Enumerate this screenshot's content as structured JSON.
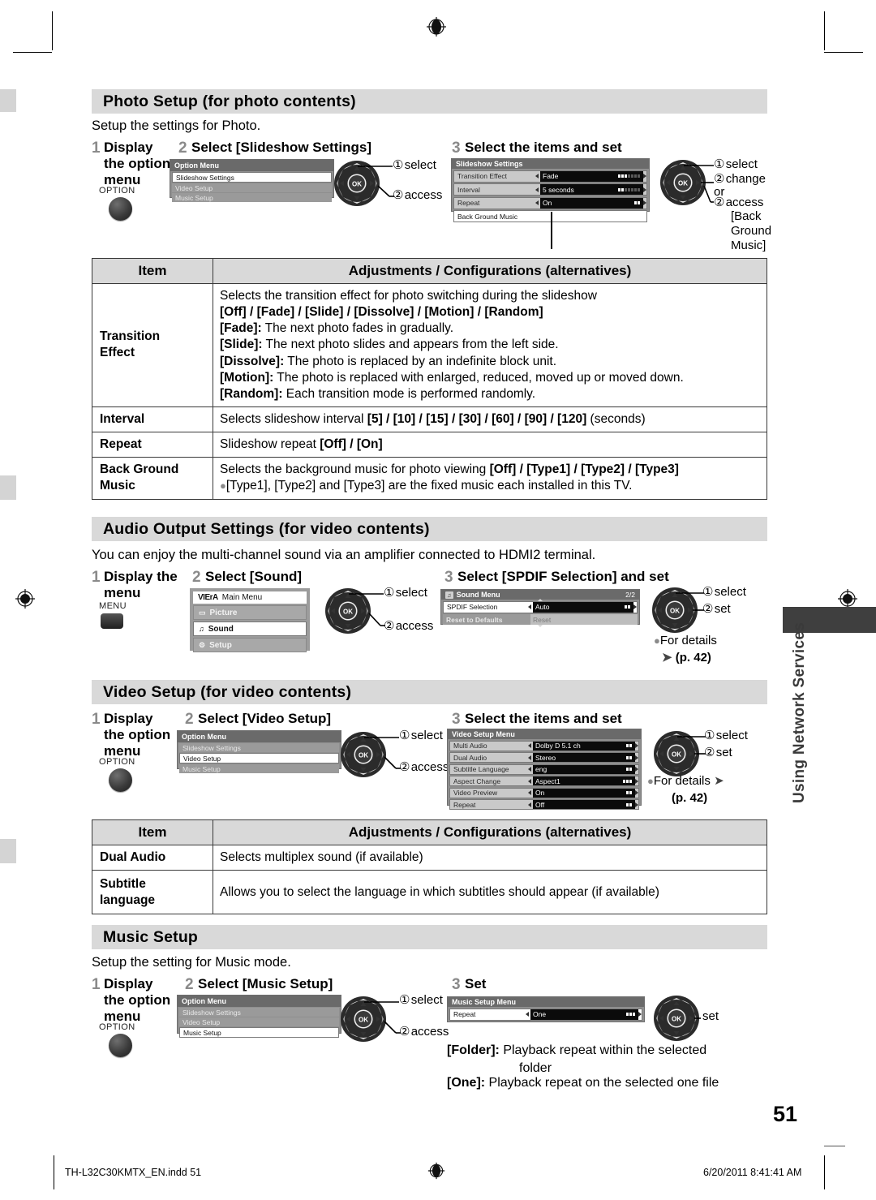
{
  "document": {
    "page_number": "51",
    "footer_left": "TH-L32C30KMTX_EN.indd   51",
    "footer_right": "6/20/2011   8:41:41 AM",
    "side_tab_text": "Using Network Services"
  },
  "sections": [
    {
      "id": "photo_setup",
      "heading": "Photo Setup (for photo contents)",
      "intro": "Setup the settings for Photo.",
      "steps": [
        {
          "num": "1",
          "label": "Display\nthe option\nmenu",
          "button_label": "OPTION"
        },
        {
          "num": "2",
          "label": "Select [Slideshow Settings]"
        },
        {
          "num": "3",
          "label": "Select the items and set"
        }
      ],
      "option_menu": {
        "title": "Option Menu",
        "rows": [
          {
            "label": "Slideshow Settings",
            "state": "selected"
          },
          {
            "label": "Video Setup",
            "state": "dim"
          },
          {
            "label": "Music Setup",
            "state": "dim"
          }
        ]
      },
      "dpad_left": {
        "items": [
          "select",
          "access"
        ],
        "numbers": [
          "1",
          "2"
        ]
      },
      "slideshow_menu": {
        "title": "Slideshow Settings",
        "rows": [
          {
            "label": "Transition Effect",
            "value": "Fade",
            "bars": 7,
            "filled": 3
          },
          {
            "label": "Interval",
            "value": "5 seconds",
            "bars": 7,
            "filled": 2
          },
          {
            "label": "Repeat",
            "value": "On",
            "bars": 2,
            "filled": 2
          },
          {
            "label": "Back Ground Music",
            "value": "",
            "plain": true
          }
        ]
      },
      "dpad_right": {
        "lines": [
          "① select",
          "② change",
          "or",
          "② access"
        ],
        "trailing": [
          "[Back",
          "Ground",
          "Music]"
        ]
      },
      "table": {
        "headers": [
          "Item",
          "Adjustments / Configurations (alternatives)"
        ],
        "rows": [
          {
            "item": "Transition\nEffect",
            "lines": [
              {
                "text": "Selects the transition effect for photo switching during the slideshow"
              },
              {
                "text": "[Off] / [Fade] / [Slide] / [Dissolve] / [Motion] / [Random]",
                "bold": true
              },
              {
                "bold_prefix": "[Fade]:",
                "text": " The next photo fades in gradually."
              },
              {
                "bold_prefix": "[Slide]:",
                "text": " The next photo slides and appears from the left side."
              },
              {
                "bold_prefix": "[Dissolve]:",
                "text": " The photo is replaced by an indefinite block unit."
              },
              {
                "bold_prefix": "[Motion]:",
                "text": " The photo is replaced with enlarged, reduced, moved up or moved down."
              },
              {
                "bold_prefix": "[Random]:",
                "text": " Each transition mode is performed randomly."
              }
            ]
          },
          {
            "item": "Interval",
            "lines": [
              {
                "text": "Selects slideshow interval ",
                "suffix_bold": "[5] / [10] / [15] / [30] / [60] / [90] / [120]",
                "suffix": " (seconds)"
              }
            ]
          },
          {
            "item": "Repeat",
            "lines": [
              {
                "text": "Slideshow repeat ",
                "suffix_bold": "[Off] / [On]",
                "suffix": ""
              }
            ]
          },
          {
            "item": "Back Ground\nMusic",
            "lines": [
              {
                "text": "Selects the background music for photo viewing ",
                "suffix_bold": "[Off] / [Type1] / [Type2] / [Type3]",
                "suffix": ""
              },
              {
                "bullet": true,
                "text": "[Type1], [Type2] and [Type3] are the fixed music each installed in this TV."
              }
            ]
          }
        ]
      }
    },
    {
      "id": "audio_output",
      "heading": "Audio Output Settings (for video contents)",
      "intro": "You can enjoy the multi-channel sound via an amplifier connected to HDMI2 terminal.",
      "steps": [
        {
          "num": "1",
          "label": "Display the\nmenu",
          "button_label": "MENU"
        },
        {
          "num": "2",
          "label": "Select [Sound]"
        },
        {
          "num": "3",
          "label": "Select [SPDIF Selection] and set"
        }
      ],
      "main_menu": {
        "brand": "VIErA",
        "title": "Main Menu",
        "rows": [
          {
            "icon": "picture-icon",
            "label": "Picture",
            "state": "dim"
          },
          {
            "icon": "sound-icon",
            "label": "Sound",
            "state": "selected"
          },
          {
            "icon": "setup-icon",
            "label": "Setup",
            "state": "dim"
          }
        ]
      },
      "dpad_left": {
        "items": [
          "select",
          "access"
        ],
        "numbers": [
          "1",
          "2"
        ]
      },
      "sound_menu": {
        "title": "Sound Menu",
        "page_indicator": "2/2",
        "rows": [
          {
            "label": "SPDIF Selection",
            "value": "Auto",
            "bars": 2,
            "filled": 2
          },
          {
            "label": "Reset to Defaults",
            "value": "Reset",
            "plain": true,
            "dim": true
          }
        ]
      },
      "dpad_right": {
        "lines": [
          "① select",
          "② set"
        ]
      },
      "details_note": "For details",
      "details_page": "(p. 42)"
    },
    {
      "id": "video_setup",
      "heading": "Video Setup (for video contents)",
      "steps": [
        {
          "num": "1",
          "label": "Display\nthe option\nmenu",
          "button_label": "OPTION"
        },
        {
          "num": "2",
          "label": "Select [Video Setup]"
        },
        {
          "num": "3",
          "label": "Select the items and set"
        }
      ],
      "option_menu": {
        "title": "Option Menu",
        "rows": [
          {
            "label": "Slideshow Settings",
            "state": "dim"
          },
          {
            "label": "Video Setup",
            "state": "selected"
          },
          {
            "label": "Music Setup",
            "state": "dim"
          }
        ]
      },
      "dpad_left": {
        "items": [
          "select",
          "access"
        ],
        "numbers": [
          "1",
          "2"
        ]
      },
      "video_menu": {
        "title": "Video Setup Menu",
        "rows": [
          {
            "label": "Multi Audio",
            "value": "Dolby D 5.1 ch",
            "bars": 2,
            "filled": 2
          },
          {
            "label": "Dual Audio",
            "value": "Stereo",
            "bars": 2,
            "filled": 2
          },
          {
            "label": "Subtitle Language",
            "value": "eng",
            "bars": 2,
            "filled": 2
          },
          {
            "label": "Aspect Change",
            "value": "Aspect1",
            "bars": 3,
            "filled": 3
          },
          {
            "label": "Video Preview",
            "value": "On",
            "bars": 2,
            "filled": 2
          },
          {
            "label": "Repeat",
            "value": "Off",
            "bars": 2,
            "filled": 2
          }
        ]
      },
      "dpad_right": {
        "lines": [
          "① select",
          "② set"
        ]
      },
      "details_note": "For details",
      "details_page": "(p. 42)",
      "table": {
        "headers": [
          "Item",
          "Adjustments / Configurations (alternatives)"
        ],
        "rows": [
          {
            "item": "Dual Audio",
            "lines": [
              {
                "text": "Selects multiplex sound (if available)"
              }
            ]
          },
          {
            "item": "Subtitle\nlanguage",
            "lines": [
              {
                "text": "Allows you to select the language in which subtitles should appear (if available)"
              }
            ]
          }
        ]
      }
    },
    {
      "id": "music_setup",
      "heading": "Music Setup",
      "intro": "Setup the setting for Music mode.",
      "steps": [
        {
          "num": "1",
          "label": "Display\nthe option\nmenu",
          "button_label": "OPTION"
        },
        {
          "num": "2",
          "label": "Select [Music Setup]"
        },
        {
          "num": "3",
          "label": "Set"
        }
      ],
      "option_menu": {
        "title": "Option Menu",
        "rows": [
          {
            "label": "Slideshow Settings",
            "state": "dim"
          },
          {
            "label": "Video Setup",
            "state": "dim"
          },
          {
            "label": "Music Setup",
            "state": "selected"
          }
        ]
      },
      "dpad_left": {
        "items": [
          "select",
          "access"
        ],
        "numbers": [
          "1",
          "2"
        ]
      },
      "music_menu": {
        "title": "Music Setup Menu",
        "rows": [
          {
            "label": "Repeat",
            "value": "One",
            "bars": 3,
            "filled": 3
          }
        ]
      },
      "dpad_right_label": "set",
      "notes": [
        {
          "bold_prefix": "[Folder]:",
          "text": " Playback repeat within the selected"
        },
        {
          "indent": true,
          "text": "folder"
        },
        {
          "bold_prefix": "[One]:",
          "text": " Playback repeat on the selected one file"
        }
      ]
    }
  ],
  "colors": {
    "section_bar": "#d9d9d9",
    "table_header": "#d9d9d9",
    "osd_bg": "#8f8f8f",
    "osd_title": "#6a6a6a",
    "side_tab": "#3f3f3f"
  }
}
